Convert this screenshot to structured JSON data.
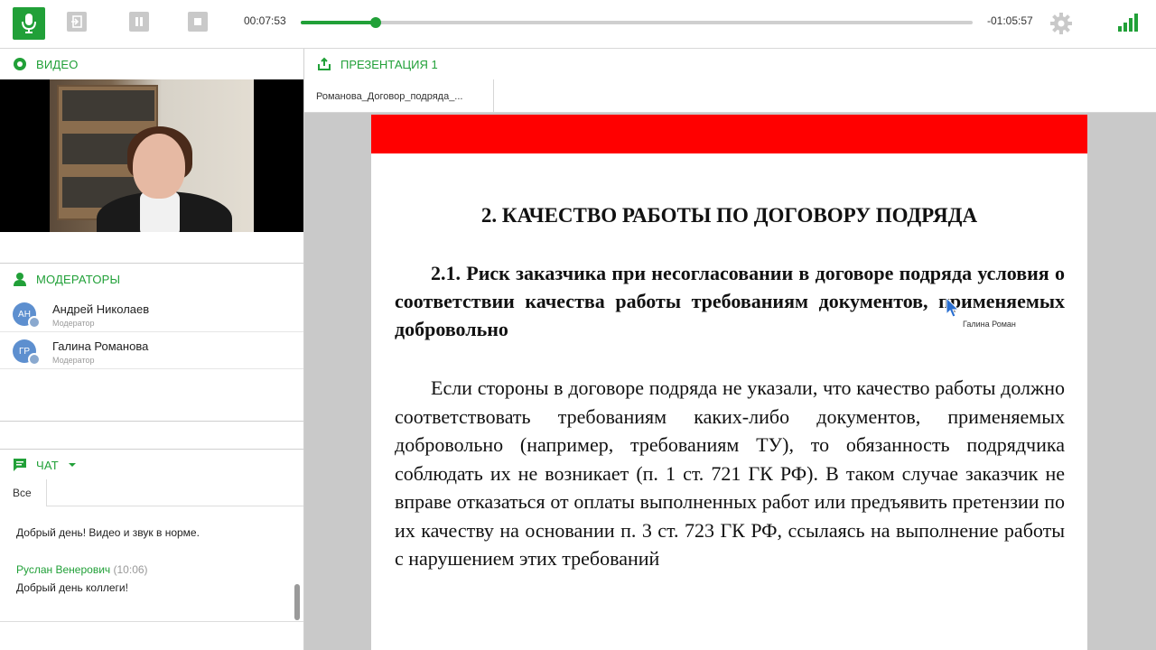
{
  "topbar": {
    "elapsed": "00:07:53",
    "remaining": "-01:05:57",
    "progress": 0.111,
    "accent": "#21a038",
    "icons": [
      "microphone-icon",
      "exit-icon",
      "pause-icon",
      "stop-icon",
      "gear-icon",
      "signal-icon"
    ]
  },
  "video": {
    "header": "ВИДЕО"
  },
  "moderators": {
    "header": "МОДЕРАТОРЫ",
    "items": [
      {
        "initials": "АН",
        "name": "Андрей Николаев",
        "role": "Модератор"
      },
      {
        "initials": "ГР",
        "name": "Галина Романова",
        "role": "Модератор"
      }
    ]
  },
  "chat": {
    "header": "ЧАТ",
    "tab": "Все",
    "messages": [
      {
        "author": "",
        "time": "",
        "text": "Добрый день! Видео и звук в норме."
      },
      {
        "author": "Руслан Венерович",
        "time": "(10:06)",
        "text": "Добрый день коллеги!"
      }
    ]
  },
  "presentation": {
    "header": "ПРЕЗЕНТАЦИЯ 1",
    "file_tab": "Романова_Договор_подряда_...",
    "slide_bar_color": "#ff0000",
    "slide_title": "2. КАЧЕСТВО РАБОТЫ ПО ДОГОВОРУ ПОДРЯДА",
    "slide_subtitle": "2.1. Риск заказчика при несогласовании в договоре подряда условия о соответствии качества работы требованиям документов, применяемых добровольно",
    "slide_body": "Если стороны в договоре подряда не указали, что качество работы должно соответствовать требованиям каких-либо документов, применяемых добровольно (например, требованиям ТУ), то обязанность подрядчика соблюдать их не возникает (п. 1 ст. 721 ГК РФ). В таком случае заказчик не вправе отказаться от оплаты выполненных работ или предъявить претензии по их качеству на основании п. 3 ст. 723 ГК РФ, ссылаясь на выполнение работы с нарушением этих требований",
    "cursor_label": "Галина Роман"
  }
}
